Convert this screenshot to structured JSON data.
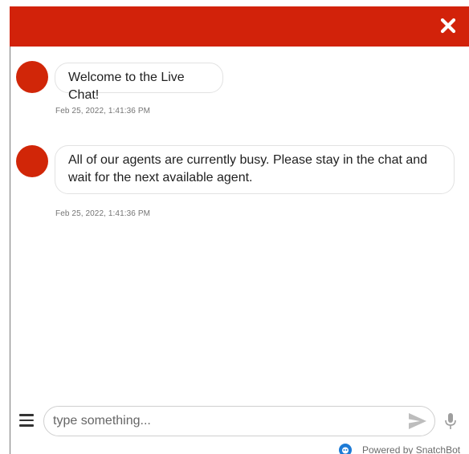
{
  "colors": {
    "header": "#d2220a",
    "avatar": "#d12608",
    "powered_logo": "#1d7bd6"
  },
  "header": {
    "close_icon": "close-icon"
  },
  "messages": [
    {
      "text": "Welcome to the Live Chat!",
      "timestamp": "Feb 25, 2022, 1:41:36 PM"
    },
    {
      "text": "All of our agents are currently busy. Please stay in the chat and wait for the next available agent.",
      "timestamp": "Feb 25, 2022, 1:41:36 PM"
    }
  ],
  "composer": {
    "menu_icon": "hamburger-menu-icon",
    "placeholder": "type something...",
    "value": "",
    "send_icon": "send-icon",
    "mic_icon": "microphone-icon"
  },
  "footer": {
    "powered_by": "Powered by SnatchBot",
    "logo_icon": "snatchbot-logo-icon"
  }
}
